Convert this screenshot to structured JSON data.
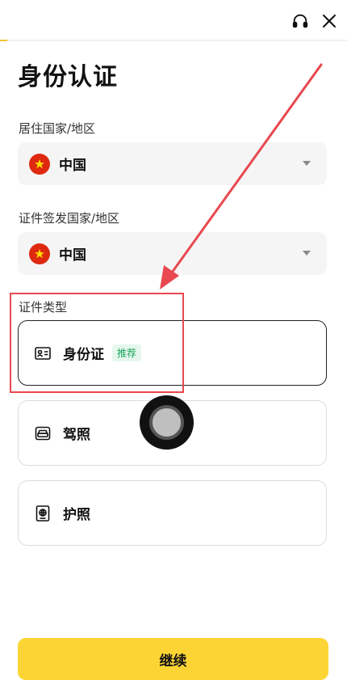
{
  "header": {
    "progress_fraction": 0.02,
    "support_icon": "headset-icon",
    "close_icon": "close-icon"
  },
  "page": {
    "title": "身份认证"
  },
  "residence": {
    "label": "居住国家/地区",
    "value": "中国",
    "flag": "china-flag-icon"
  },
  "issuer": {
    "label": "证件签发国家/地区",
    "value": "中国",
    "flag": "china-flag-icon"
  },
  "document_type": {
    "label": "证件类型",
    "options": [
      {
        "label": "身份证",
        "badge": "推荐",
        "icon": "id-card-icon",
        "selected": true
      },
      {
        "label": "驾照",
        "icon": "car-icon",
        "selected": false
      },
      {
        "label": "护照",
        "icon": "passport-icon",
        "selected": false
      }
    ]
  },
  "footer": {
    "continue_label": "继续"
  },
  "colors": {
    "accent": "#fcd535",
    "annotation": "#e8484f",
    "badge_text": "#17a55a",
    "badge_bg": "#e6f7ee"
  }
}
